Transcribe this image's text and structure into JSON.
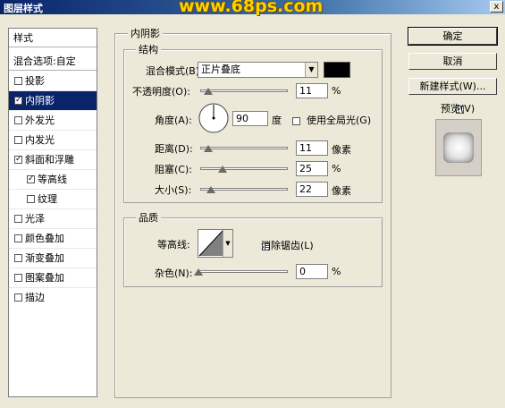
{
  "window": {
    "title": "图层样式",
    "watermark": "www.68ps.com",
    "close_glyph": "x"
  },
  "sidebar": {
    "header": "样式",
    "blend_options": "混合选项:自定",
    "items": [
      {
        "label": "投影",
        "checked": false,
        "selected": false
      },
      {
        "label": "内阴影",
        "checked": true,
        "selected": true
      },
      {
        "label": "外发光",
        "checked": false,
        "selected": false
      },
      {
        "label": "内发光",
        "checked": false,
        "selected": false
      },
      {
        "label": "斜面和浮雕",
        "checked": true,
        "selected": false
      },
      {
        "label": "等高线",
        "checked": true,
        "selected": false
      },
      {
        "label": "纹理",
        "checked": false,
        "selected": false
      },
      {
        "label": "光泽",
        "checked": false,
        "selected": false
      },
      {
        "label": "颜色叠加",
        "checked": false,
        "selected": false
      },
      {
        "label": "渐变叠加",
        "checked": false,
        "selected": false
      },
      {
        "label": "图案叠加",
        "checked": false,
        "selected": false
      },
      {
        "label": "描边",
        "checked": false,
        "selected": false
      }
    ]
  },
  "panel": {
    "title": "内阴影",
    "structure": {
      "title": "结构",
      "blend_mode_label": "混合模式(B):",
      "blend_mode_value": "正片叠底",
      "blend_color": "#000000",
      "opacity_label": "不透明度(O):",
      "opacity_value": "11",
      "opacity_unit": "%",
      "angle_label": "角度(A):",
      "angle_value": "90",
      "angle_unit": "度",
      "global_light_label": "使用全局光(G)",
      "global_light_checked": false,
      "distance_label": "距离(D):",
      "distance_value": "11",
      "distance_unit": "像素",
      "choke_label": "阻塞(C):",
      "choke_value": "25",
      "choke_unit": "%",
      "size_label": "大小(S):",
      "size_value": "22",
      "size_unit": "像素"
    },
    "quality": {
      "title": "品质",
      "contour_label": "等高线:",
      "antialias_label": "消除锯齿(L)",
      "antialias_checked": false,
      "noise_label": "杂色(N):",
      "noise_value": "0",
      "noise_unit": "%"
    }
  },
  "buttons": {
    "ok": "确定",
    "cancel": "取消",
    "new_style": "新建样式(W)...",
    "preview_label": "预览(V)",
    "preview_checked": true
  }
}
